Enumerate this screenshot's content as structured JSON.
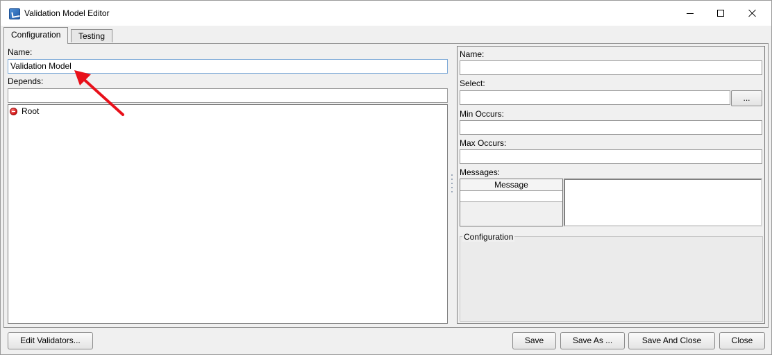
{
  "window": {
    "title": "Validation Model Editor",
    "icon": "app-icon"
  },
  "tabs": [
    {
      "label": "Configuration",
      "active": true
    },
    {
      "label": "Testing",
      "active": false
    }
  ],
  "left": {
    "name_label": "Name:",
    "name_value": "Validation Model",
    "depends_label": "Depends:",
    "depends_value": "",
    "tree": [
      {
        "label": "Root",
        "icon": "error-icon"
      }
    ]
  },
  "right": {
    "name_label": "Name:",
    "name_value": "",
    "select_label": "Select:",
    "select_value": "",
    "browse_label": "...",
    "min_occurs_label": "Min Occurs:",
    "min_occurs_value": "",
    "max_occurs_label": "Max Occurs:",
    "max_occurs_value": "",
    "messages_label": "Messages:",
    "messages_columns": [
      "Message"
    ],
    "configuration_label": "Configuration"
  },
  "footer": {
    "edit_validators": "Edit Validators...",
    "save": "Save",
    "save_as": "Save As ...",
    "save_and_close": "Save And Close",
    "close": "Close"
  },
  "annotation": {
    "color": "#e8101a"
  }
}
